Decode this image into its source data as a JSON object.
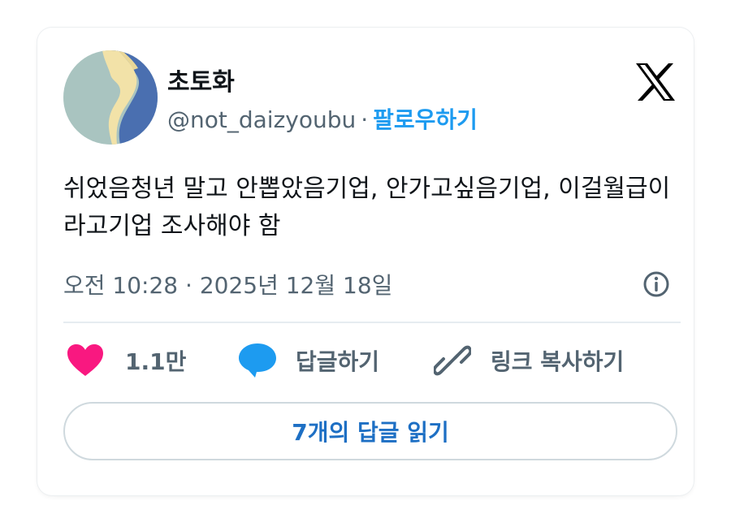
{
  "user": {
    "display_name": "초토화",
    "handle": "@not_daizyoubu",
    "separator": "·",
    "follow_label": "팔로우하기"
  },
  "platform": {
    "logo_icon": "x-logo-icon"
  },
  "tweet": {
    "text": "쉬었음청년 말고 안뽑았음기업, 안가고싶음기업, 이걸월급이라고기업 조사해야 함",
    "timestamp": "오전 10:28 · 2025년 12월 18일"
  },
  "actions": {
    "like_count": "1.1만",
    "reply_label": "답글하기",
    "copy_link_label": "링크 복사하기"
  },
  "read_replies_label": "7개의 답글 읽기",
  "colors": {
    "accent": "#1d9bf0",
    "heart": "#f91880",
    "text": "#0f1419",
    "muted": "#536471",
    "reply_button_text": "#1d6fc4"
  }
}
